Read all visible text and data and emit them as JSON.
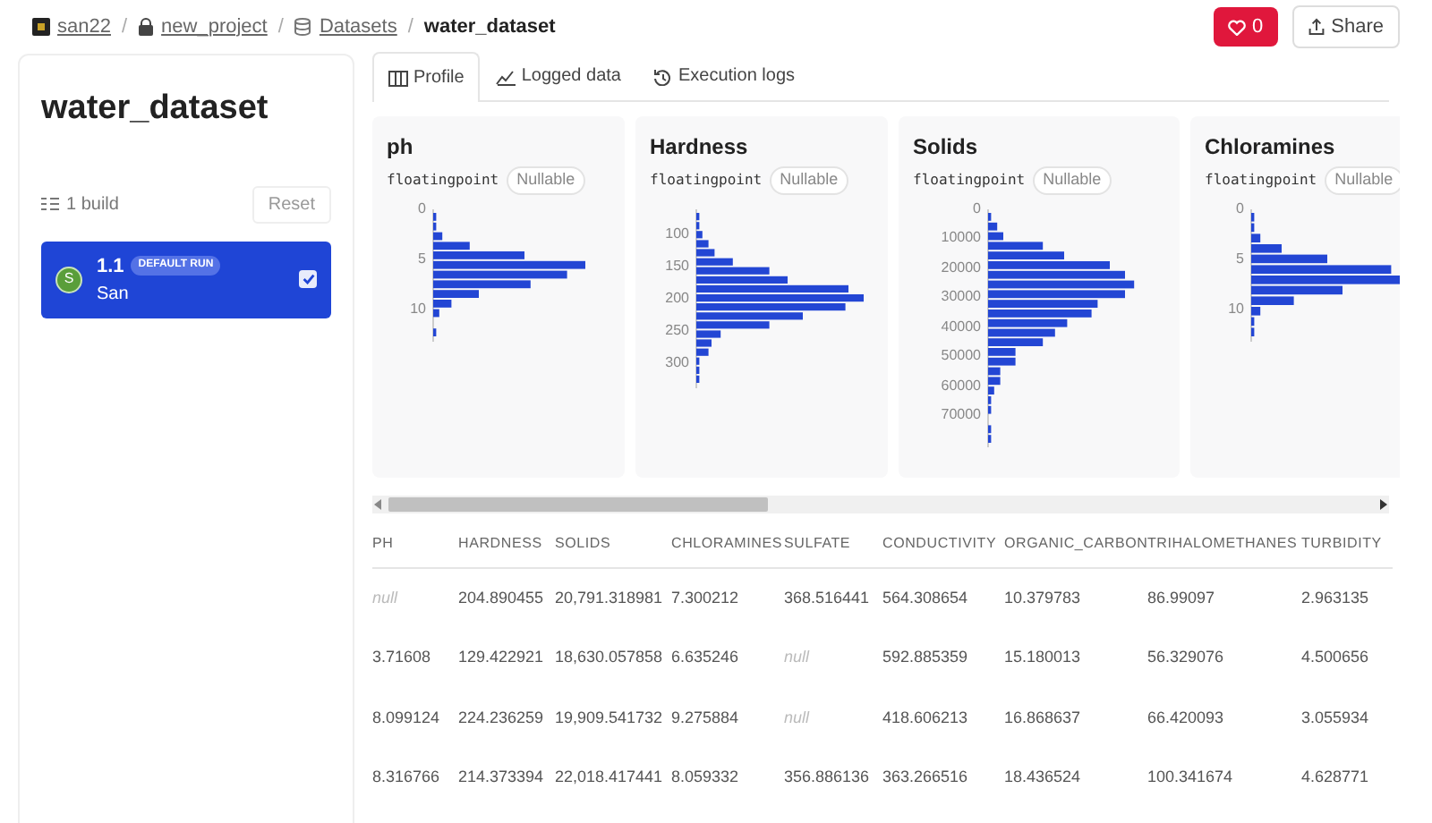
{
  "breadcrumb": [
    {
      "text": "san22",
      "kind": "org"
    },
    {
      "text": "/",
      "kind": "separator"
    },
    {
      "text": "new_project",
      "kind": "project"
    },
    {
      "text": "/",
      "kind": "separator"
    },
    {
      "text": "Datasets",
      "kind": "section"
    },
    {
      "text": "/",
      "kind": "separator"
    },
    {
      "text": "water_dataset",
      "kind": "current"
    }
  ],
  "likes": {
    "count": "0"
  },
  "share": {
    "label": "Share"
  },
  "sidebar": {
    "title": "water_dataset",
    "build_count": "1 build",
    "reset": "Reset",
    "builds": [
      {
        "version": "1.1",
        "badge": "DEFAULT RUN",
        "author": "San",
        "avatar": "S",
        "checked": true,
        "selected": true
      }
    ]
  },
  "tabs": [
    {
      "label": "Profile",
      "selected": true,
      "kind": "profile"
    },
    {
      "label": "Logged data",
      "selected": false,
      "kind": "logged"
    },
    {
      "label": "Execution logs",
      "selected": false,
      "kind": "logs"
    }
  ],
  "columns_profile": [
    {
      "name": "ph",
      "type": "floatingpoint",
      "nullable": "Nullable",
      "ticks": [
        "0",
        "5",
        "10"
      ]
    },
    {
      "name": "Hardness",
      "type": "floatingpoint",
      "nullable": "Nullable",
      "ticks": [
        "100",
        "150",
        "200",
        "250",
        "300"
      ]
    },
    {
      "name": "Solids",
      "type": "floatingpoint",
      "nullable": "Nullable",
      "ticks": [
        "0",
        "10000",
        "20000",
        "30000",
        "40000",
        "50000",
        "60000",
        "70000"
      ]
    },
    {
      "name": "Chloramines",
      "type": "floatingpoint",
      "nullable": "Nullable",
      "ticks": [
        "0",
        "5",
        "10"
      ]
    }
  ],
  "table": {
    "columns": [
      "PH",
      "HARDNESS",
      "SOLIDS",
      "CHLORAMINES",
      "SULFATE",
      "CONDUCTIVITY",
      "ORGANIC_CARBON",
      "TRIHALOMETHANES",
      "TURBIDITY"
    ],
    "rows": [
      [
        "null",
        "204.890455",
        "20,791.318981",
        "7.300212",
        "368.516441",
        "564.308654",
        "10.379783",
        "86.99097",
        "2.963135"
      ],
      [
        "3.71608",
        "129.422921",
        "18,630.057858",
        "6.635246",
        "null",
        "592.885359",
        "15.180013",
        "56.329076",
        "4.500656"
      ],
      [
        "8.099124",
        "224.236259",
        "19,909.541732",
        "9.275884",
        "null",
        "418.606213",
        "16.868637",
        "66.420093",
        "3.055934"
      ],
      [
        "8.316766",
        "214.373394",
        "22,018.417441",
        "8.059332",
        "356.886136",
        "363.266516",
        "18.436524",
        "100.341674",
        "4.628771"
      ]
    ]
  }
}
